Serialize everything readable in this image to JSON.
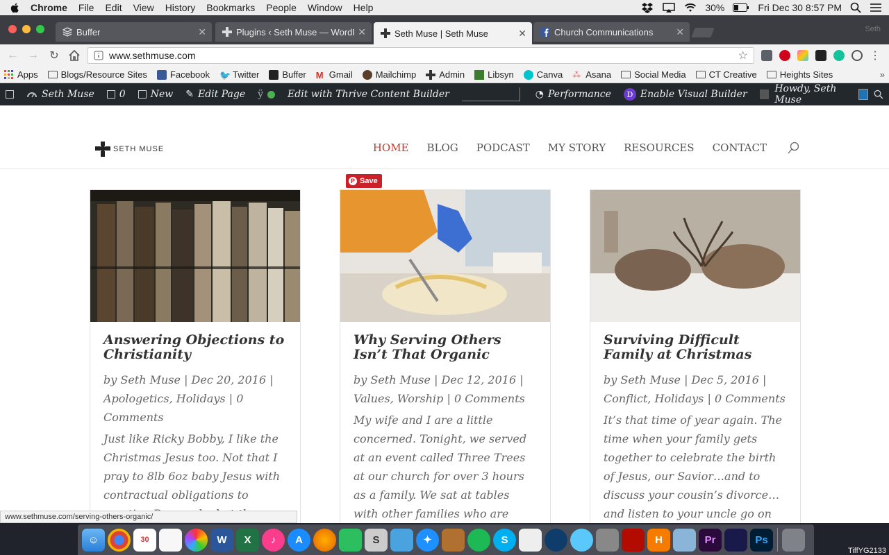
{
  "macbar": {
    "app": "Chrome",
    "menus": [
      "File",
      "Edit",
      "View",
      "History",
      "Bookmarks",
      "People",
      "Window",
      "Help"
    ],
    "battery": "30%",
    "clock": "Fri Dec 30  8:57 PM"
  },
  "tabs": [
    {
      "label": "Buffer",
      "icon": "buffer-icon"
    },
    {
      "label": "Plugins ‹ Seth Muse — WordPr",
      "icon": "wordpress-cross-icon"
    },
    {
      "label": "Seth Muse | Seth Muse",
      "icon": "seth-muse-cross-icon"
    },
    {
      "label": "Church Communications",
      "icon": "facebook-icon"
    }
  ],
  "profile_name": "Seth",
  "address_bar": {
    "url": "www.sethmuse.com"
  },
  "bookmarks": [
    "Apps",
    "Blogs/Resource Sites",
    "Facebook",
    "Twitter",
    "Buffer",
    "Gmail",
    "Mailchimp",
    "Admin",
    "Libsyn",
    "Canva",
    "Asana",
    "Social Media",
    "CT Creative",
    "Heights Sites"
  ],
  "wpbar": {
    "site": "Seth Muse",
    "comments": "0",
    "new": "New",
    "edit": "Edit Page",
    "thrive": "Edit with Thrive Content Builder",
    "performance": "Performance",
    "visual_builder": "Enable Visual Builder",
    "howdy": "Howdy, Seth Muse"
  },
  "site": {
    "logo_text": "SETH MUSE",
    "nav": [
      "HOME",
      "BLOG",
      "PODCAST",
      "MY STORY",
      "RESOURCES",
      "CONTACT"
    ],
    "pin_save": "Save",
    "posts": [
      {
        "title": "Answering Objections to Christianity",
        "meta": "by Seth Muse | Dec 20, 2016 | Apologetics, Holidays | 0 Comments",
        "excerpt": "Just like Ricky Bobby, I like the Christmas Jesus too. Not that I pray to 8lb 6oz baby Jesus with contractual obligations to mention Powerade, but the advent of our Saviour is the fruit of our limitation of"
      },
      {
        "title": "Why Serving Others Isn’t That Organic",
        "meta": "by Seth Muse | Dec 12, 2016 | Values, Worship | 0 Comments",
        "excerpt": "My wife and I are a little concerned. Tonight, we served at an event called Three Trees at our church for over 3 hours as a family. We sat at tables with other families who are struggling to provide Christmas presents for"
      },
      {
        "title": "Surviving Difficult Family at Christmas",
        "meta": "by Seth Muse | Dec 5, 2016 | Conflict, Holidays | 0 Comments",
        "excerpt": "It’s that time of year again. The time when your family gets together to celebrate the birth of Jesus, our Savior…and to discuss your cousin’s divorce…and listen to your uncle go on and on about politics (which he"
      }
    ]
  },
  "status_url": "www.sethmuse.com/serving-others-organic/",
  "dock_label": "TiffYG2133"
}
